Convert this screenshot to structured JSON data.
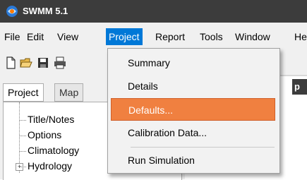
{
  "window": {
    "title": "SWMM 5.1"
  },
  "menubar": {
    "items": [
      {
        "label": "File"
      },
      {
        "label": "Edit"
      },
      {
        "label": "View"
      },
      {
        "label": "Project"
      },
      {
        "label": "Report"
      },
      {
        "label": "Tools"
      },
      {
        "label": "Window"
      },
      {
        "label": "He"
      }
    ],
    "active": "Project"
  },
  "toolbar": {
    "icons": [
      "new-file-icon",
      "open-folder-icon",
      "save-icon",
      "print-icon"
    ]
  },
  "browser": {
    "tabs": [
      {
        "label": "Project",
        "selected": true
      },
      {
        "label": "Map",
        "selected": false
      }
    ],
    "tree": [
      {
        "label": "Title/Notes",
        "expandable": false
      },
      {
        "label": "Options",
        "expandable": false
      },
      {
        "label": "Climatology",
        "expandable": false
      },
      {
        "label": "Hydrology",
        "expandable": true
      }
    ]
  },
  "right_panel": {
    "caption_fragment": "p"
  },
  "project_menu": {
    "items": [
      {
        "label": "Summary",
        "underline": "S"
      },
      {
        "label": "Details",
        "underline": "D"
      },
      {
        "label": "Defaults...",
        "underline": "f",
        "highlighted": true
      },
      {
        "label": "Calibration Data...",
        "underline": "C"
      },
      {
        "label": "Run Simulation",
        "underline": "R"
      }
    ]
  },
  "colors": {
    "titlebar": "#3c3c3c",
    "menu_active": "#0078d7",
    "highlight": "#f08040",
    "menu_bg": "#f2f2f2"
  }
}
